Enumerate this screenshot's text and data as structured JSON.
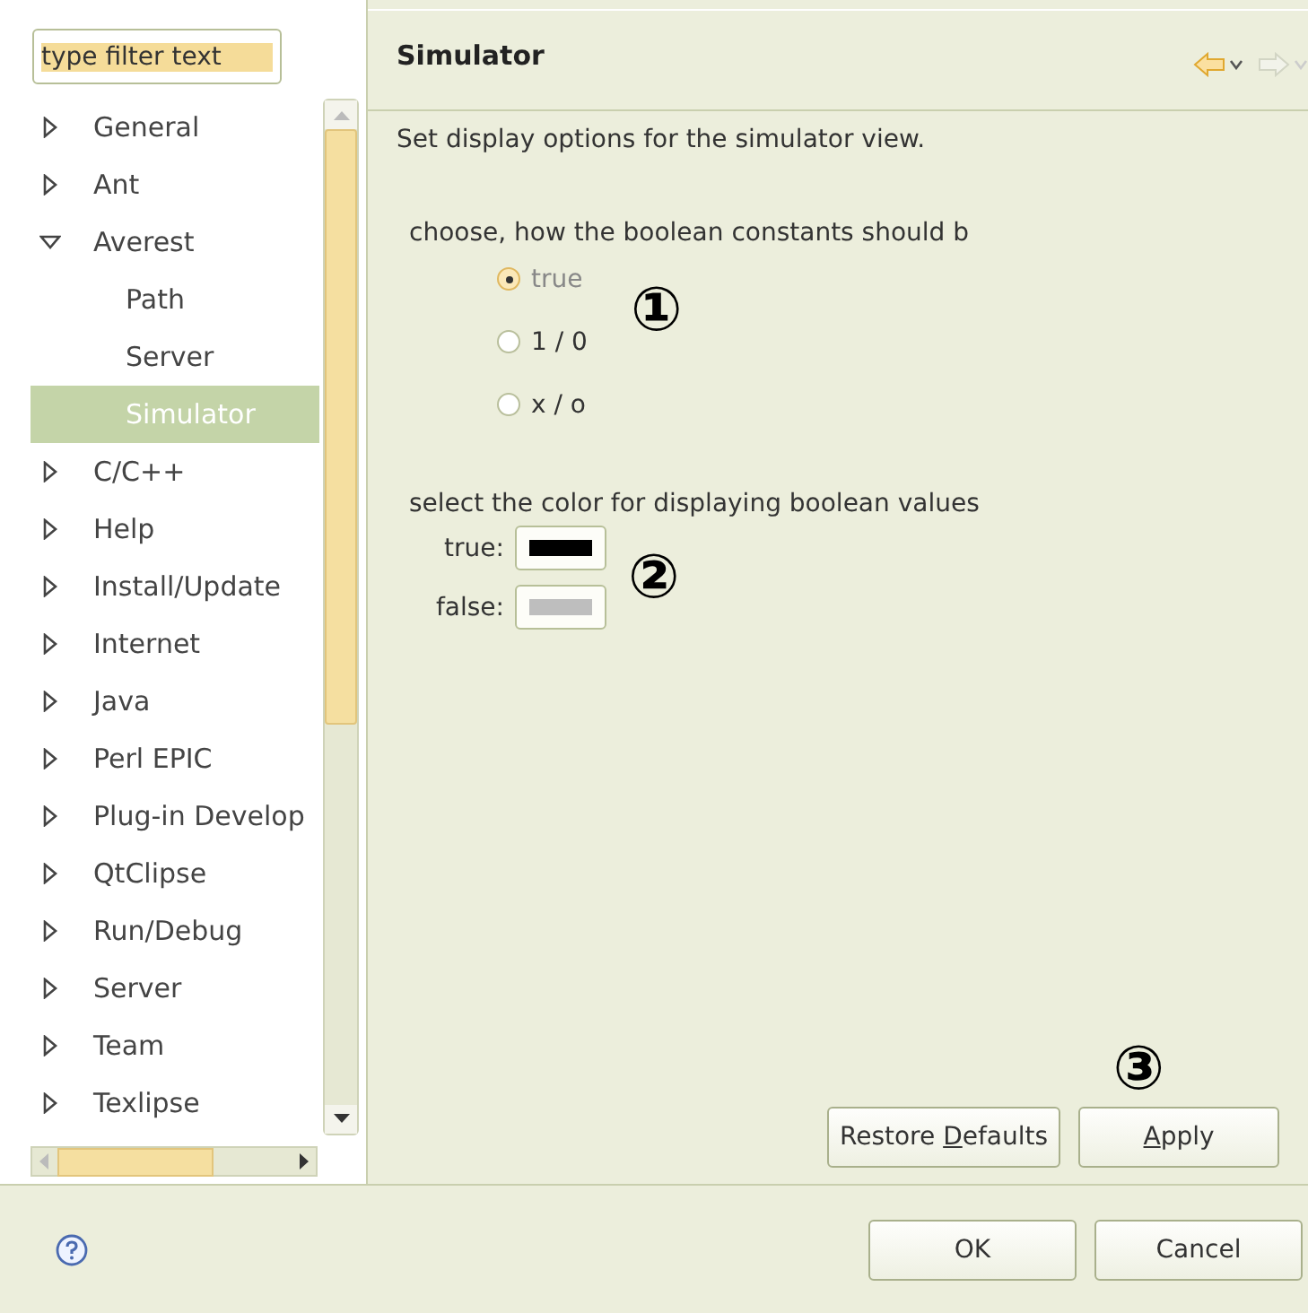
{
  "filter": {
    "placeholder": "type filter text"
  },
  "tree": [
    {
      "label": "General",
      "expanded": false,
      "selected": false
    },
    {
      "label": "Ant",
      "expanded": false,
      "selected": false
    },
    {
      "label": "Averest",
      "expanded": true,
      "selected": false,
      "children": [
        {
          "label": "Path",
          "selected": false
        },
        {
          "label": "Server",
          "selected": false
        },
        {
          "label": "Simulator",
          "selected": true
        }
      ]
    },
    {
      "label": "C/C++",
      "expanded": false,
      "selected": false
    },
    {
      "label": "Help",
      "expanded": false,
      "selected": false
    },
    {
      "label": "Install/Update",
      "expanded": false,
      "selected": false
    },
    {
      "label": "Internet",
      "expanded": false,
      "selected": false
    },
    {
      "label": "Java",
      "expanded": false,
      "selected": false
    },
    {
      "label": "Perl EPIC",
      "expanded": false,
      "selected": false
    },
    {
      "label": "Plug-in Develop",
      "expanded": false,
      "selected": false
    },
    {
      "label": "QtClipse",
      "expanded": false,
      "selected": false
    },
    {
      "label": "Run/Debug",
      "expanded": false,
      "selected": false
    },
    {
      "label": "Server",
      "expanded": false,
      "selected": false
    },
    {
      "label": "Team",
      "expanded": false,
      "selected": false
    },
    {
      "label": "Texlipse",
      "expanded": false,
      "selected": false
    }
  ],
  "page": {
    "title": "Simulator",
    "nav": [
      {
        "kind": "back",
        "disabled": false
      },
      {
        "kind": "forward",
        "disabled": true
      }
    ],
    "description": "Set display options for the simulator view.",
    "boolean_group": {
      "label": "choose, how the boolean constants should b",
      "options": [
        {
          "label": "true",
          "selected": true
        },
        {
          "label": "1 / 0",
          "selected": false
        },
        {
          "label": "x / o",
          "selected": false
        }
      ],
      "callout": "①"
    },
    "color_group": {
      "label": "select the color for displaying boolean values",
      "pickers": [
        {
          "label": "true:",
          "color": "#000000"
        },
        {
          "label": "false:",
          "color": "#bebebe"
        }
      ],
      "callout": "②"
    },
    "buttons_callout": "③",
    "buttons": [
      {
        "before": "Restore ",
        "key": "D",
        "after": "efaults"
      },
      {
        "key": "A",
        "after": "pply"
      }
    ]
  },
  "dialog_buttons": [
    "OK",
    "Cancel"
  ]
}
